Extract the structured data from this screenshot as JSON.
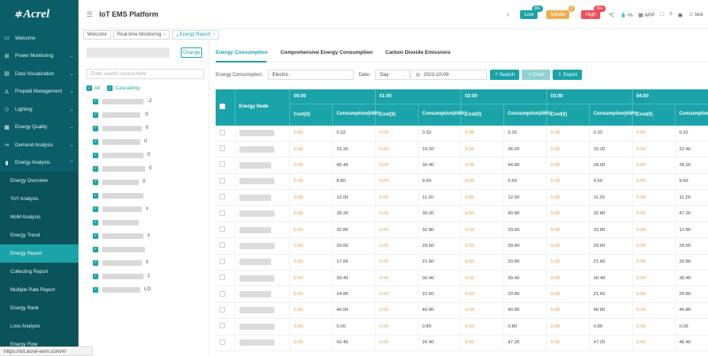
{
  "brand": {
    "logo_text": "Acrel",
    "platform_title": "IoT EMS Platform"
  },
  "header": {
    "low_label": "Low",
    "low_count": "99+",
    "middle_label": "Middle",
    "middle_count": "2",
    "high_label": "High",
    "high_count": "99+",
    "temp_text": "℃",
    "humidity_text": "-%",
    "app_label": "APP",
    "user_label": "test",
    "colors": {
      "low": "#1aa3a8",
      "middle": "#f0ad4e",
      "high": "#ee4d5a"
    }
  },
  "sidebar": {
    "items": [
      {
        "label": "Welcome",
        "icon": "monitor-icon"
      },
      {
        "label": "Power Monitoring",
        "icon": "power-icon"
      },
      {
        "label": "Data Visualization",
        "icon": "chart-icon"
      },
      {
        "label": "Prepaid Management",
        "icon": "person-icon"
      },
      {
        "label": "Lighting",
        "icon": "bulb-icon"
      },
      {
        "label": "Energy Quality",
        "icon": "quality-icon"
      },
      {
        "label": "Demand Analysis",
        "icon": "demand-icon"
      },
      {
        "label": "Energy Analysis",
        "icon": "bar-chart-icon"
      }
    ],
    "sub_items": [
      "Energy Overview",
      "YoY Analysis",
      "MoM Analysis",
      "Energy Trend",
      "Energy Report",
      "Collecting Report",
      "Multiple Rate Report",
      "Energy Rank",
      "Loss Analysis",
      "Energy Flow"
    ]
  },
  "tabs": {
    "welcome": "Welcome",
    "realtime": "Real-time Monitoring",
    "report": "Energy Report"
  },
  "left_panel": {
    "change_label": "Change",
    "search_placeholder": "Enter search content here",
    "all_label": "All",
    "cascading_label": "Cascading",
    "tree_items": [
      "-2",
      ":0",
      "0",
      "0",
      "0",
      "0",
      "0",
      "",
      "x",
      "",
      "x",
      "",
      "0",
      "1",
      "LO"
    ]
  },
  "main": {
    "tabs": [
      "Energy Consumption",
      "Comprehensive Energy Consumption",
      "Carbon Dioxide Emissions"
    ],
    "filter": {
      "energy_label": "Energy Consumption:",
      "energy_value": "Electric",
      "date_label": "Date:",
      "date_type": "Day",
      "date_value": "2022-10-09",
      "search_label": "Search",
      "chart_label": "Chart",
      "export_label": "Export"
    },
    "table": {
      "node_header": "Energy Node",
      "hours": [
        "00:00",
        "01:00",
        "02:00",
        "03:00",
        "04:00"
      ],
      "cost_header": "Cost(¥)",
      "cons_header": "Consumption(kWh)",
      "rows": [
        [
          "0.00",
          "0.32",
          "0.00",
          "0.32",
          "0.00",
          "0.32",
          "0.00",
          "0.32",
          "0.00",
          "0.32"
        ],
        [
          "0.00",
          "31.20",
          "0.00",
          "19.20",
          "0.00",
          "36.00",
          "0.00",
          "15.20",
          "0.00",
          "22.40"
        ],
        [
          "0.00",
          "46.40",
          "0.00",
          "30.40",
          "0.00",
          "44.80",
          "0.00",
          "28.00",
          "0.00",
          "39.20"
        ],
        [
          "0.00",
          "8.80",
          "0.00",
          "9.60",
          "0.00",
          "9.60",
          "0.00",
          "9.60",
          "0.00",
          "9.60"
        ],
        [
          "0.00",
          "12.00",
          "0.00",
          "11.20",
          "0.00",
          "12.00",
          "0.00",
          "11.20",
          "0.00",
          "11.20"
        ],
        [
          "0.00",
          "39.20",
          "0.00",
          "39.20",
          "0.00",
          "40.80",
          "0.00",
          "32.80",
          "0.00",
          "47.20"
        ],
        [
          "0.00",
          "32.80",
          "0.00",
          "32.80",
          "0.00",
          "33.60",
          "0.00",
          "32.80",
          "0.00",
          "12.80"
        ],
        [
          "0.00",
          "29.60",
          "0.00",
          "29.60",
          "0.00",
          "29.60",
          "0.00",
          "29.60",
          "0.00",
          "29.60"
        ],
        [
          "0.00",
          "17.60",
          "0.00",
          "21.60",
          "0.00",
          "20.80",
          "0.00",
          "21.60",
          "0.00",
          "20.80"
        ],
        [
          "0.00",
          "30.40",
          "0.00",
          "30.40",
          "0.00",
          "30.40",
          "0.00",
          "30.40",
          "0.00",
          "30.40"
        ],
        [
          "0.00",
          "24.80",
          "0.00",
          "21.60",
          "0.00",
          "20.80",
          "0.00",
          "21.60",
          "0.00",
          "20.80"
        ],
        [
          "0.00",
          "40.00",
          "0.00",
          "40.80",
          "0.00",
          "40.80",
          "0.00",
          "40.80",
          "0.00",
          "40.80"
        ],
        [
          "0.00",
          "0.00",
          "0.00",
          "0.80",
          "0.00",
          "0.80",
          "0.00",
          "0.80",
          "0.00",
          "0.00"
        ],
        [
          "0.00",
          "42.40",
          "0.00",
          "26.40",
          "0.00",
          "47.20",
          "0.00",
          "47.20",
          "0.00",
          "46.40"
        ]
      ]
    }
  },
  "status_url": "https://iot.acrel-eem.com/#/"
}
